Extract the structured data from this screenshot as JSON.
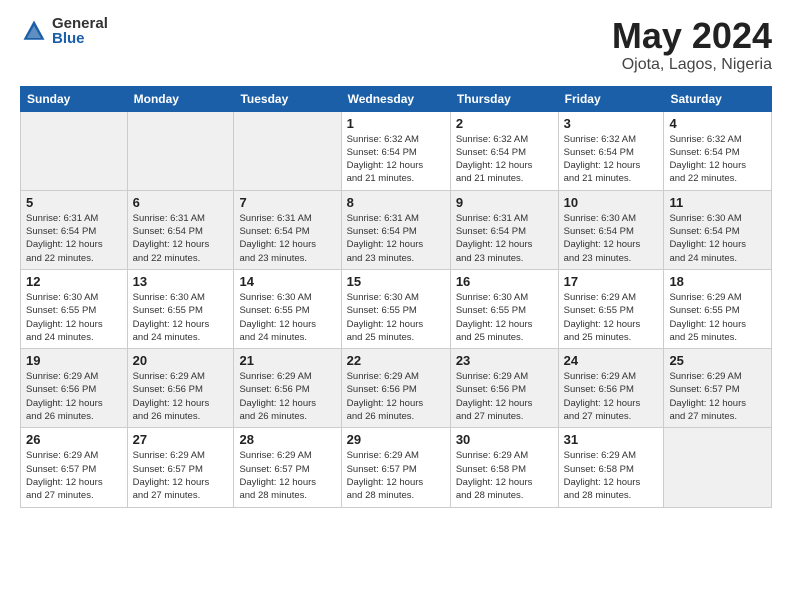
{
  "header": {
    "logo_general": "General",
    "logo_blue": "Blue",
    "title": "May 2024",
    "location": "Ojota, Lagos, Nigeria"
  },
  "days_of_week": [
    "Sunday",
    "Monday",
    "Tuesday",
    "Wednesday",
    "Thursday",
    "Friday",
    "Saturday"
  ],
  "weeks": [
    [
      {
        "day": "",
        "info": ""
      },
      {
        "day": "",
        "info": ""
      },
      {
        "day": "",
        "info": ""
      },
      {
        "day": "1",
        "info": "Sunrise: 6:32 AM\nSunset: 6:54 PM\nDaylight: 12 hours\nand 21 minutes."
      },
      {
        "day": "2",
        "info": "Sunrise: 6:32 AM\nSunset: 6:54 PM\nDaylight: 12 hours\nand 21 minutes."
      },
      {
        "day": "3",
        "info": "Sunrise: 6:32 AM\nSunset: 6:54 PM\nDaylight: 12 hours\nand 21 minutes."
      },
      {
        "day": "4",
        "info": "Sunrise: 6:32 AM\nSunset: 6:54 PM\nDaylight: 12 hours\nand 22 minutes."
      }
    ],
    [
      {
        "day": "5",
        "info": "Sunrise: 6:31 AM\nSunset: 6:54 PM\nDaylight: 12 hours\nand 22 minutes."
      },
      {
        "day": "6",
        "info": "Sunrise: 6:31 AM\nSunset: 6:54 PM\nDaylight: 12 hours\nand 22 minutes."
      },
      {
        "day": "7",
        "info": "Sunrise: 6:31 AM\nSunset: 6:54 PM\nDaylight: 12 hours\nand 23 minutes."
      },
      {
        "day": "8",
        "info": "Sunrise: 6:31 AM\nSunset: 6:54 PM\nDaylight: 12 hours\nand 23 minutes."
      },
      {
        "day": "9",
        "info": "Sunrise: 6:31 AM\nSunset: 6:54 PM\nDaylight: 12 hours\nand 23 minutes."
      },
      {
        "day": "10",
        "info": "Sunrise: 6:30 AM\nSunset: 6:54 PM\nDaylight: 12 hours\nand 23 minutes."
      },
      {
        "day": "11",
        "info": "Sunrise: 6:30 AM\nSunset: 6:54 PM\nDaylight: 12 hours\nand 24 minutes."
      }
    ],
    [
      {
        "day": "12",
        "info": "Sunrise: 6:30 AM\nSunset: 6:55 PM\nDaylight: 12 hours\nand 24 minutes."
      },
      {
        "day": "13",
        "info": "Sunrise: 6:30 AM\nSunset: 6:55 PM\nDaylight: 12 hours\nand 24 minutes."
      },
      {
        "day": "14",
        "info": "Sunrise: 6:30 AM\nSunset: 6:55 PM\nDaylight: 12 hours\nand 24 minutes."
      },
      {
        "day": "15",
        "info": "Sunrise: 6:30 AM\nSunset: 6:55 PM\nDaylight: 12 hours\nand 25 minutes."
      },
      {
        "day": "16",
        "info": "Sunrise: 6:30 AM\nSunset: 6:55 PM\nDaylight: 12 hours\nand 25 minutes."
      },
      {
        "day": "17",
        "info": "Sunrise: 6:29 AM\nSunset: 6:55 PM\nDaylight: 12 hours\nand 25 minutes."
      },
      {
        "day": "18",
        "info": "Sunrise: 6:29 AM\nSunset: 6:55 PM\nDaylight: 12 hours\nand 25 minutes."
      }
    ],
    [
      {
        "day": "19",
        "info": "Sunrise: 6:29 AM\nSunset: 6:56 PM\nDaylight: 12 hours\nand 26 minutes."
      },
      {
        "day": "20",
        "info": "Sunrise: 6:29 AM\nSunset: 6:56 PM\nDaylight: 12 hours\nand 26 minutes."
      },
      {
        "day": "21",
        "info": "Sunrise: 6:29 AM\nSunset: 6:56 PM\nDaylight: 12 hours\nand 26 minutes."
      },
      {
        "day": "22",
        "info": "Sunrise: 6:29 AM\nSunset: 6:56 PM\nDaylight: 12 hours\nand 26 minutes."
      },
      {
        "day": "23",
        "info": "Sunrise: 6:29 AM\nSunset: 6:56 PM\nDaylight: 12 hours\nand 27 minutes."
      },
      {
        "day": "24",
        "info": "Sunrise: 6:29 AM\nSunset: 6:56 PM\nDaylight: 12 hours\nand 27 minutes."
      },
      {
        "day": "25",
        "info": "Sunrise: 6:29 AM\nSunset: 6:57 PM\nDaylight: 12 hours\nand 27 minutes."
      }
    ],
    [
      {
        "day": "26",
        "info": "Sunrise: 6:29 AM\nSunset: 6:57 PM\nDaylight: 12 hours\nand 27 minutes."
      },
      {
        "day": "27",
        "info": "Sunrise: 6:29 AM\nSunset: 6:57 PM\nDaylight: 12 hours\nand 27 minutes."
      },
      {
        "day": "28",
        "info": "Sunrise: 6:29 AM\nSunset: 6:57 PM\nDaylight: 12 hours\nand 28 minutes."
      },
      {
        "day": "29",
        "info": "Sunrise: 6:29 AM\nSunset: 6:57 PM\nDaylight: 12 hours\nand 28 minutes."
      },
      {
        "day": "30",
        "info": "Sunrise: 6:29 AM\nSunset: 6:58 PM\nDaylight: 12 hours\nand 28 minutes."
      },
      {
        "day": "31",
        "info": "Sunrise: 6:29 AM\nSunset: 6:58 PM\nDaylight: 12 hours\nand 28 minutes."
      },
      {
        "day": "",
        "info": ""
      }
    ]
  ]
}
